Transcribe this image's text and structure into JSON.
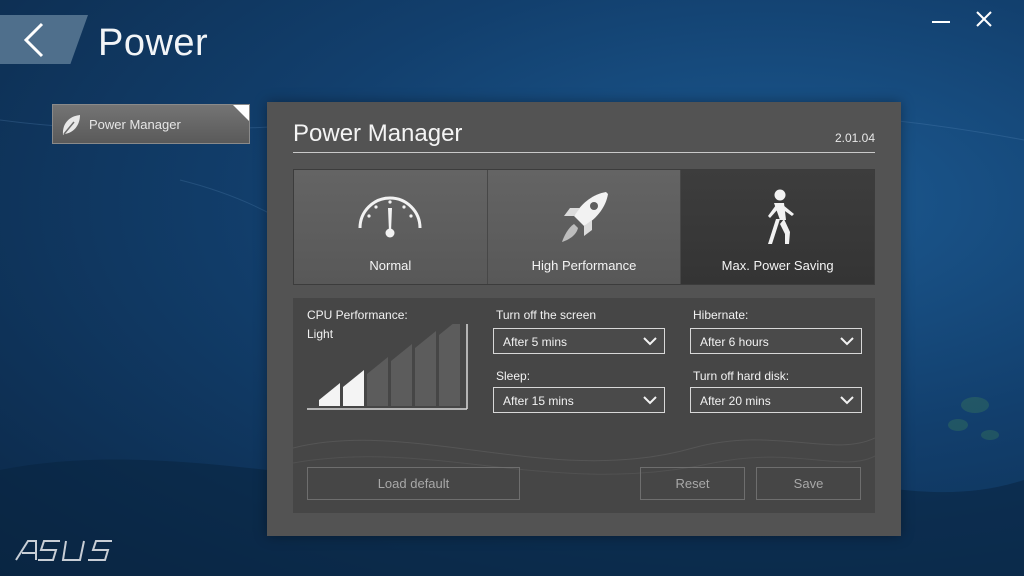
{
  "header": {
    "title": "Power"
  },
  "sidebar": {
    "items": [
      {
        "label": "Power Manager",
        "icon": "leaf-icon"
      }
    ]
  },
  "panel": {
    "title": "Power Manager",
    "version": "2.01.04",
    "modes": [
      {
        "label": "Normal",
        "icon": "speedometer-icon",
        "selected": false
      },
      {
        "label": "High Performance",
        "icon": "rocket-icon",
        "selected": false
      },
      {
        "label": "Max. Power Saving",
        "icon": "walking-person-icon",
        "selected": true
      }
    ],
    "cpu": {
      "label": "CPU Performance:",
      "level_text": "Light",
      "level": 2,
      "max_level": 6
    },
    "screen_off": {
      "label": "Turn off the screen",
      "value": "After 5 mins"
    },
    "sleep": {
      "label": "Sleep:",
      "value": "After 15 mins"
    },
    "hibernate": {
      "label": "Hibernate:",
      "value": "After 6 hours"
    },
    "hdd_off": {
      "label": "Turn off hard disk:",
      "value": "After 20 mins"
    },
    "buttons": {
      "load_default": "Load default",
      "reset": "Reset",
      "save": "Save"
    }
  },
  "brand": {
    "logo_text": "ASUS"
  },
  "colors": {
    "panel": "#535353",
    "selected_mode": "#3a3a3a",
    "background": "#123f6d"
  }
}
